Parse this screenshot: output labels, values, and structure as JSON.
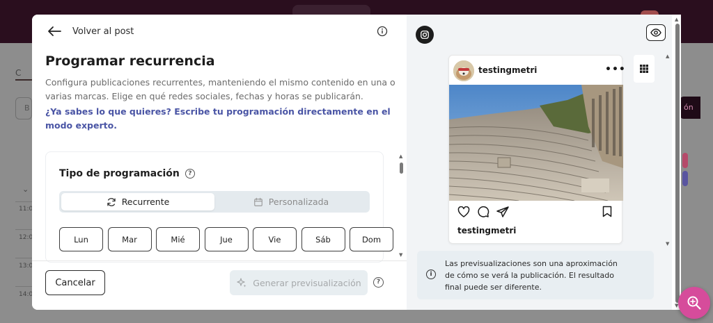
{
  "background": {
    "tab_initial": "C",
    "search_initial": "B",
    "hours": [
      "11:0",
      "12:0",
      "13:0",
      "14:0"
    ],
    "right_button_fragment": "ón"
  },
  "header": {
    "back_label": "Volver al post"
  },
  "main": {
    "title": "Programar recurrencia",
    "description": "Configura publicaciones recurrentes, manteniendo el mismo contenido en una o varias marcas. Elige en qué redes sociales, fechas y horas se publicarán.",
    "expert_link": "¿Ya sabes lo que quieres? Escribe tu programación directamente en el modo experto."
  },
  "schedule": {
    "type_label": "Tipo de programación",
    "help_glyph": "?",
    "toggle": {
      "recurrent": "Recurrente",
      "custom": "Personalizada"
    },
    "days": [
      "Lun",
      "Mar",
      "Mié",
      "Jue",
      "Vie",
      "Sáb",
      "Dom"
    ]
  },
  "footer": {
    "cancel_label": "Cancelar",
    "generate_label": "Generar previsualización",
    "help_glyph": "?"
  },
  "preview": {
    "username": "testingmetri",
    "more_glyph": "•••",
    "caption_username": "testingmetri",
    "notice": "Las previsualizaciones son una aproximación de cómo se verá la publicación. El resultado final puede ser diferente.",
    "notice_glyph": "i"
  },
  "colors": {
    "link": "#4a55a5",
    "fab": "#d64c9b",
    "topbar": "#2a0e1e"
  }
}
